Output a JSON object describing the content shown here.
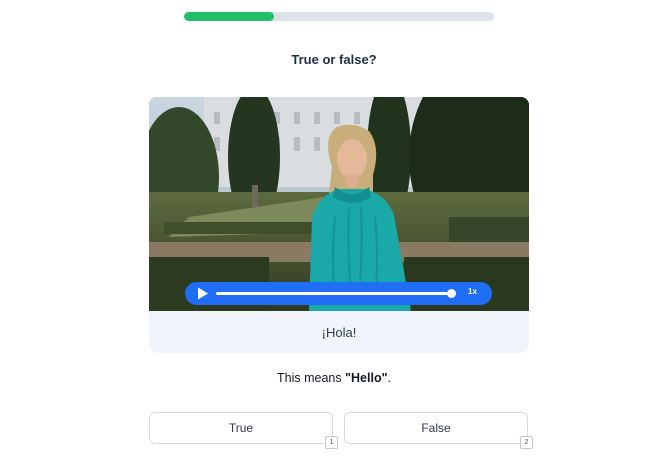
{
  "progress": {
    "fraction": 0.29,
    "fill_color": "#20c06a",
    "track_color": "#dfe3ea"
  },
  "prompt": "True or false?",
  "video": {
    "controls_color": "#1f6ef5",
    "play_icon": "play-icon",
    "speed_label": "1x",
    "playback_fraction": 0.98
  },
  "caption": "¡Hola!",
  "meaning": {
    "prefix": "This means ",
    "term": "\"Hello\"",
    "suffix": "."
  },
  "answers": [
    {
      "label": "True",
      "key": "1"
    },
    {
      "label": "False",
      "key": "2"
    }
  ]
}
